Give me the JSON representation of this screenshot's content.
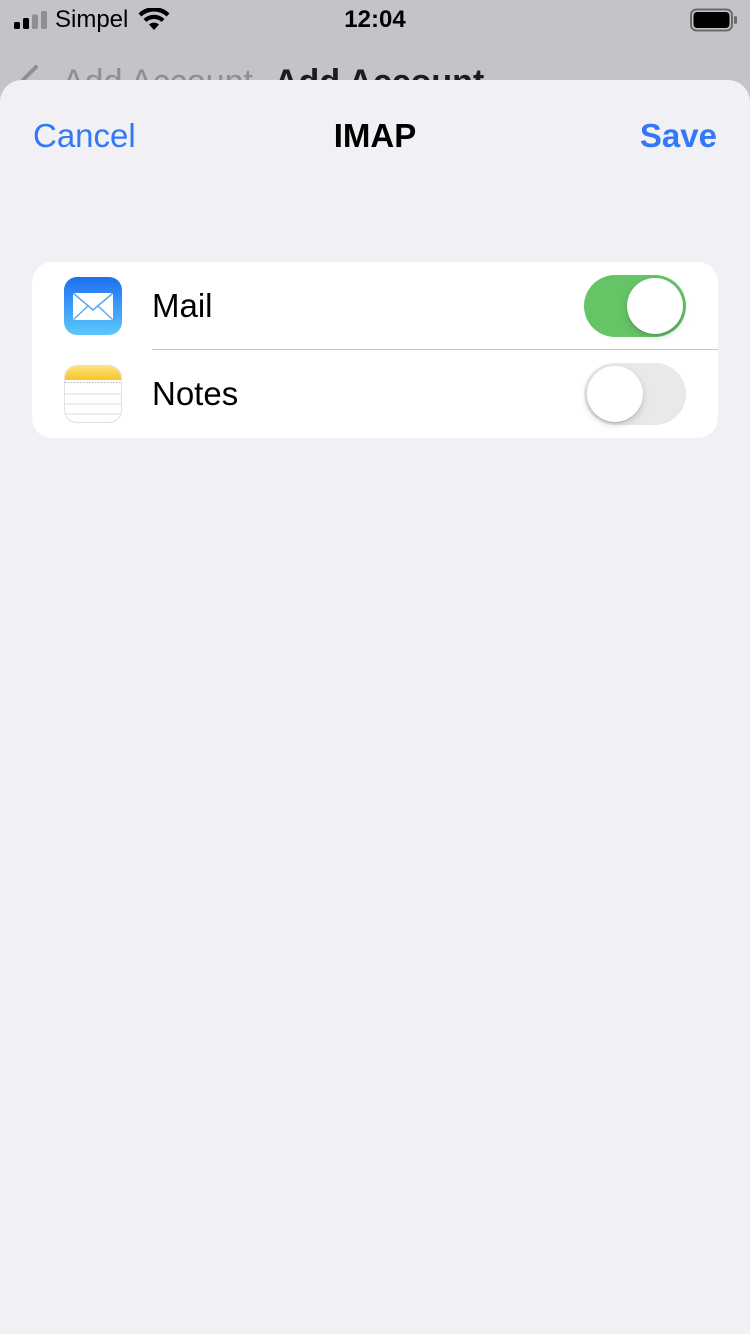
{
  "status_bar": {
    "carrier": "Simpel",
    "time": "12:04",
    "signal_bars": 4,
    "signal_bars_filled": 2
  },
  "behind_nav": {
    "back_label": "Add Account",
    "title": "Add Account"
  },
  "sheet": {
    "cancel_label": "Cancel",
    "title": "IMAP",
    "save_label": "Save"
  },
  "settings": {
    "items": [
      {
        "label": "Mail",
        "icon": "mail-icon",
        "enabled": true
      },
      {
        "label": "Notes",
        "icon": "notes-icon",
        "enabled": false
      }
    ]
  },
  "colors": {
    "accent": "#3478f6",
    "toggle_on": "#65c466",
    "toggle_off": "#e9e9eb",
    "sheet_background": "#f0f0f5"
  }
}
